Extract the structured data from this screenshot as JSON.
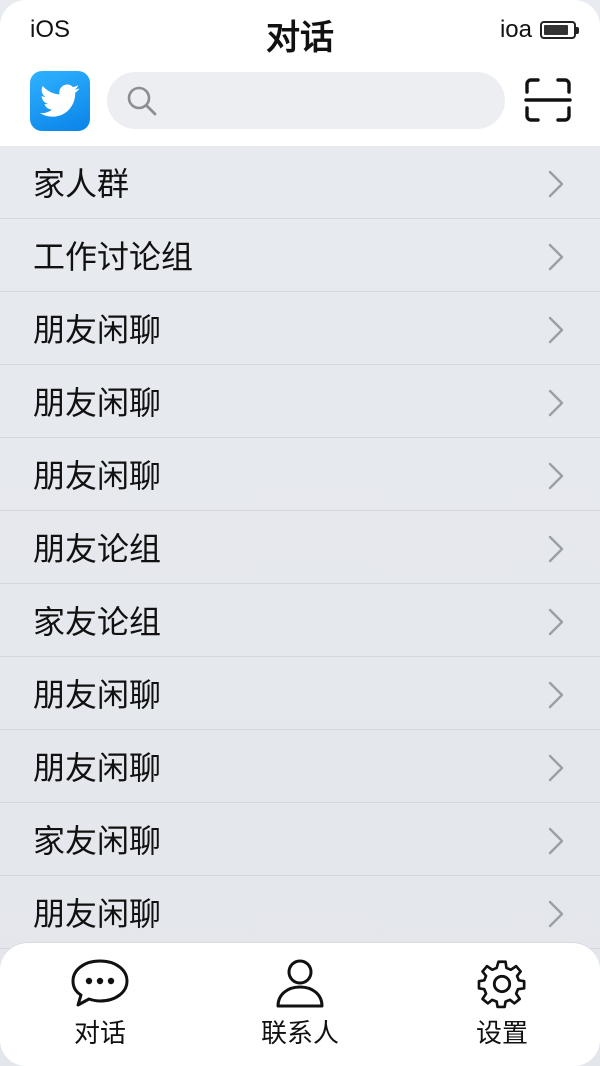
{
  "status": {
    "left": "iOS",
    "right": "ioa"
  },
  "header": {
    "title": "对话"
  },
  "search": {
    "placeholder": "",
    "value": ""
  },
  "colors": {
    "brand": "#1d9bf0",
    "list_bg": "#e6e9ee"
  },
  "icons": {
    "logo": "twitter-bird-icon",
    "search": "search-icon",
    "scan": "scan-icon",
    "chevron": "chevron-right-icon",
    "chat": "chat-bubble-icon",
    "contacts": "person-icon",
    "settings": "gear-icon"
  },
  "conversations": [
    {
      "label": "家人群"
    },
    {
      "label": "工作讨论组"
    },
    {
      "label": "朋友闲聊"
    },
    {
      "label": "朋友闲聊"
    },
    {
      "label": "朋友闲聊"
    },
    {
      "label": "朋友论组"
    },
    {
      "label": "家友论组"
    },
    {
      "label": "朋友闲聊"
    },
    {
      "label": "朋友闲聊"
    },
    {
      "label": "家友闲聊"
    },
    {
      "label": "朋友闲聊"
    }
  ],
  "tabbar": {
    "tabs": [
      {
        "label": "对话"
      },
      {
        "label": "联系人"
      },
      {
        "label": "设置"
      }
    ]
  }
}
